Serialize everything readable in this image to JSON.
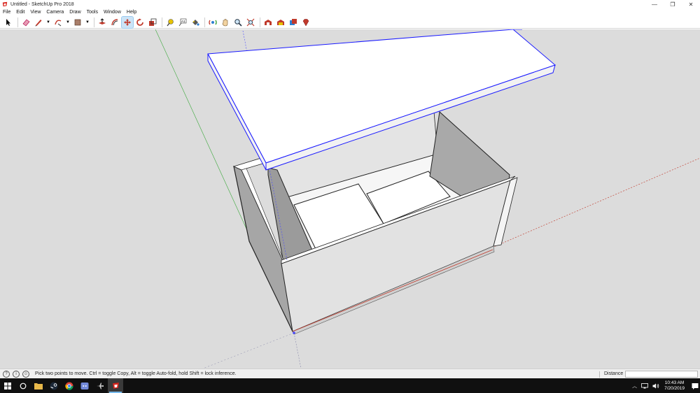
{
  "window": {
    "title": "Untitled - SketchUp Pro 2018",
    "controls": {
      "minimize": "—",
      "maximize": "❐",
      "close": "✕"
    }
  },
  "menu": [
    "File",
    "Edit",
    "View",
    "Camera",
    "Draw",
    "Tools",
    "Window",
    "Help"
  ],
  "toolbar": {
    "tools": [
      {
        "name": "select-tool",
        "icon": "arrow-icon"
      },
      {
        "name": "eraser-tool",
        "icon": "eraser-icon"
      },
      {
        "name": "line-tool",
        "icon": "pencil-icon",
        "dropdown": true
      },
      {
        "name": "arc-tool",
        "icon": "arc-icon",
        "dropdown": true
      },
      {
        "name": "shape-tool",
        "icon": "rectangle-icon",
        "dropdown": true
      },
      {
        "name": "push-pull-tool",
        "icon": "push-pull-icon"
      },
      {
        "name": "offset-tool",
        "icon": "offset-icon"
      },
      {
        "name": "move-tool",
        "icon": "move-icon",
        "active": true
      },
      {
        "name": "rotate-tool",
        "icon": "rotate-icon"
      },
      {
        "name": "scale-tool",
        "icon": "scale-icon"
      },
      {
        "name": "tape-measure-tool",
        "icon": "tape-icon"
      },
      {
        "name": "text-tool",
        "icon": "text-icon"
      },
      {
        "name": "paint-bucket-tool",
        "icon": "paint-bucket-icon"
      },
      {
        "name": "orbit-tool",
        "icon": "orbit-icon"
      },
      {
        "name": "pan-tool",
        "icon": "hand-icon"
      },
      {
        "name": "zoom-tool",
        "icon": "magnifier-icon"
      },
      {
        "name": "zoom-extents-tool",
        "icon": "zoom-extents-icon"
      },
      {
        "name": "3d-warehouse-button",
        "icon": "warehouse-icon"
      },
      {
        "name": "extension-warehouse-button",
        "icon": "extension-icon"
      },
      {
        "name": "send-to-layout-button",
        "icon": "layout-icon"
      },
      {
        "name": "extension-manager-button",
        "icon": "ruby-icon"
      }
    ],
    "text_tool_glyph": "A1"
  },
  "status": {
    "message": "Pick two points to move.  Ctrl = toggle Copy, Alt = toggle Auto-fold, hold Shift = lock inference.",
    "vcb_label": "Distance",
    "vcb_value": ""
  },
  "taskbar": {
    "apps": [
      "start-icon",
      "cortana-icon",
      "file-explorer-icon",
      "steam-icon",
      "chrome-icon",
      "discord-icon",
      "plane-icon",
      "sketchup-icon"
    ],
    "active_app": "sketchup-icon",
    "time": "10:43 AM",
    "date": "7/20/2019"
  },
  "colors": {
    "viewport_bg": "#dcdcdc",
    "selection": "#1a1aff",
    "red_axis": "#c0392b",
    "green_axis": "#2e9b2e",
    "blue_axis": "#4a4aff",
    "taskbar": "#101010",
    "active_tool": "#cce4f7"
  }
}
